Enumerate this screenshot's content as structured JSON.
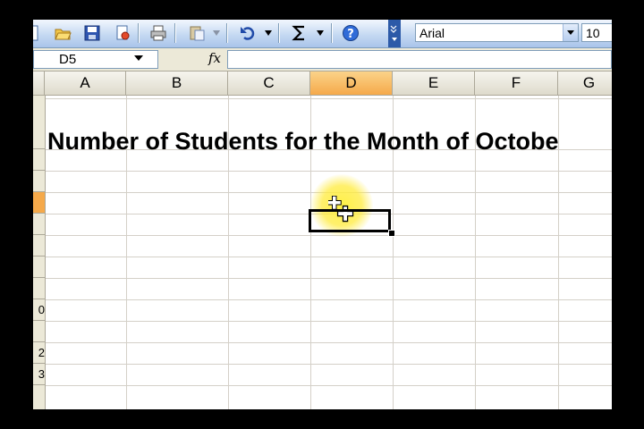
{
  "toolbar": {
    "buttons": [
      {
        "name": "open-icon"
      },
      {
        "name": "save-icon"
      },
      {
        "name": "print-preview-icon"
      },
      {
        "name": "print-icon"
      },
      {
        "name": "paste-icon"
      },
      {
        "name": "undo-icon"
      },
      {
        "name": "autosum-icon"
      },
      {
        "name": "help-icon"
      }
    ],
    "font_name": "Arial",
    "font_size": "10"
  },
  "formula_bar": {
    "name_box": "D5",
    "fx_label": "fx",
    "formula": ""
  },
  "grid": {
    "columns": [
      "A",
      "B",
      "C",
      "D",
      "E",
      "F",
      "G"
    ],
    "active_column": "D",
    "rows": [
      "",
      "",
      "",
      "",
      "",
      "",
      "",
      "",
      "0",
      "",
      "2",
      "3"
    ],
    "active_cell": "D5",
    "title_cell_text": "Number of Students for the Month of Octobe"
  },
  "colors": {
    "accent_header": "#f5a94a",
    "toolbar_blue": "#c5d9f2",
    "cursor_halo": "#ffeb3c"
  }
}
